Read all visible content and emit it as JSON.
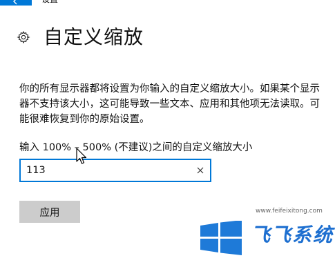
{
  "window": {
    "title": "设置"
  },
  "header": {
    "title": "自定义缩放"
  },
  "description": "你的所有显示器都将设置为你输入的自定义缩放大小。如果某个显示器不支持该大小，这可能导致一些文本、应用和其他项无法读取。可能很难恢复到你的原始设置。",
  "input": {
    "label": "输入 100% – 500% (不建议)之间的自定义缩放大小",
    "value": "113"
  },
  "apply_button": {
    "label": "应用"
  },
  "watermark": {
    "url": "www.feifeixitong.com",
    "brand": "飞飞系统"
  },
  "colors": {
    "accent": "#0078d7",
    "button_bg": "#cccccc",
    "watermark_blue": "#1d6fd0"
  },
  "icons": {
    "back": "back-arrow-icon",
    "gear": "gear-icon",
    "clear": "close-icon",
    "cursor": "mouse-cursor-icon",
    "logo": "windows-logo-icon"
  }
}
